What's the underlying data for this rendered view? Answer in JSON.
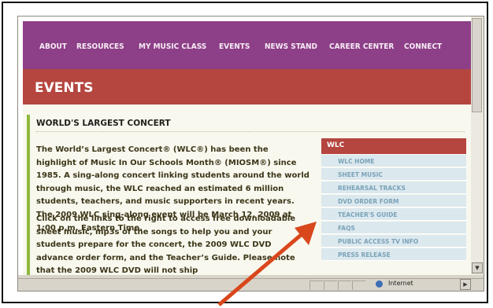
{
  "nav": {
    "items": [
      "ABOUT",
      "RESOURCES",
      "MY MUSIC CLASS",
      "EVENTS",
      "NEWS STAND",
      "CAREER CENTER",
      "CONNECT"
    ]
  },
  "page": {
    "title": "EVENTS",
    "section_title": "WORLD'S LARGEST CONCERT",
    "paragraph1": "The World’s Largest Concert® (WLC®) has been the highlight of Music In Our Schools Month® (MIOSM®) since 1985. A sing-along concert linking students around the world through music, the WLC reached an estimated 6 million students, teachers, and music supporters in recent years.  The 2009 WLC sing-along event will be March 12, 2009 at 1:00 p.m. Eastern Time.",
    "paragraph2": "Click on the links to the right to access free downloadable sheet music, mp3s of the songs to help you and your students prepare for the concert, the 2009 WLC DVD advance order form, and the Teacher’s Guide. Please note that the 2009 WLC DVD will not ship"
  },
  "wlc_box": {
    "heading": "WLC",
    "links": [
      "WLC HOME",
      "SHEET MUSIC",
      "REHEARSAL TRACKS",
      "DVD ORDER FORM",
      "TEACHER'S GUIDE",
      "FAQS",
      "PUBLIC ACCESS TV INFO",
      "PRESS RELEASE"
    ]
  },
  "status_bar": {
    "zone": "Internet"
  },
  "colors": {
    "nav_bg": "#8d3f87",
    "title_band": "#b5463f",
    "accent_green": "#8fb93e",
    "sidebar_link_bg": "#dbe8ee",
    "annotation_arrow": "#d9471c"
  },
  "icons": {
    "globe": "internet-zone-icon",
    "pointer": "annotation-arrow-icon"
  }
}
